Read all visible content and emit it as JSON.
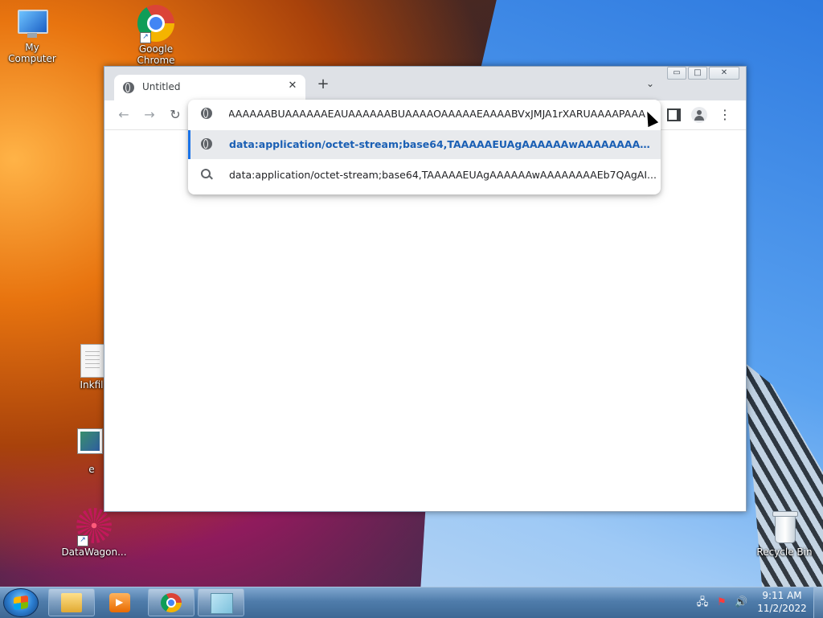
{
  "desktop": {
    "icons": [
      {
        "label": "My Computer"
      },
      {
        "label": "Google\nChrome"
      },
      {
        "label": "Inkfil"
      },
      {
        "label": "e"
      },
      {
        "label": "DataWagon..."
      },
      {
        "label": "Recycle Bin"
      }
    ]
  },
  "browser": {
    "tab": {
      "title": "Untitled",
      "close_glyph": "✕"
    },
    "new_tab_glyph": "+",
    "tab_search_glyph": "⌄",
    "window_buttons": {
      "minimize": "▭",
      "maximize": "□",
      "close": "✕"
    },
    "nav": {
      "back": "←",
      "forward": "→",
      "reload": "↻"
    },
    "menu_glyph": "⋮",
    "omnibox": {
      "input_text": "AAAAAABUAAAAAAEAUAAAAAABUAAAAOAAAAAEAAAABVxJMJA1rXARUAAAAPAAA",
      "suggestions": [
        {
          "icon": "globe-icon",
          "text": "data:application/octet-stream;base64,TAAAAAEUAgAAAAAAwAAAAAAAAEb7...",
          "selected": true
        },
        {
          "icon": "search-icon",
          "text": "data:application/octet-stream;base64,TAAAAAEUAgAAAAAAwAAAAAAAAEb7QAgAI...",
          "selected": false
        }
      ]
    }
  },
  "taskbar": {
    "clock": {
      "time": "9:11 AM",
      "date": "11/2/2022"
    },
    "tray": {
      "network": "🖧",
      "flag": "⚑",
      "volume": "🔊"
    }
  }
}
